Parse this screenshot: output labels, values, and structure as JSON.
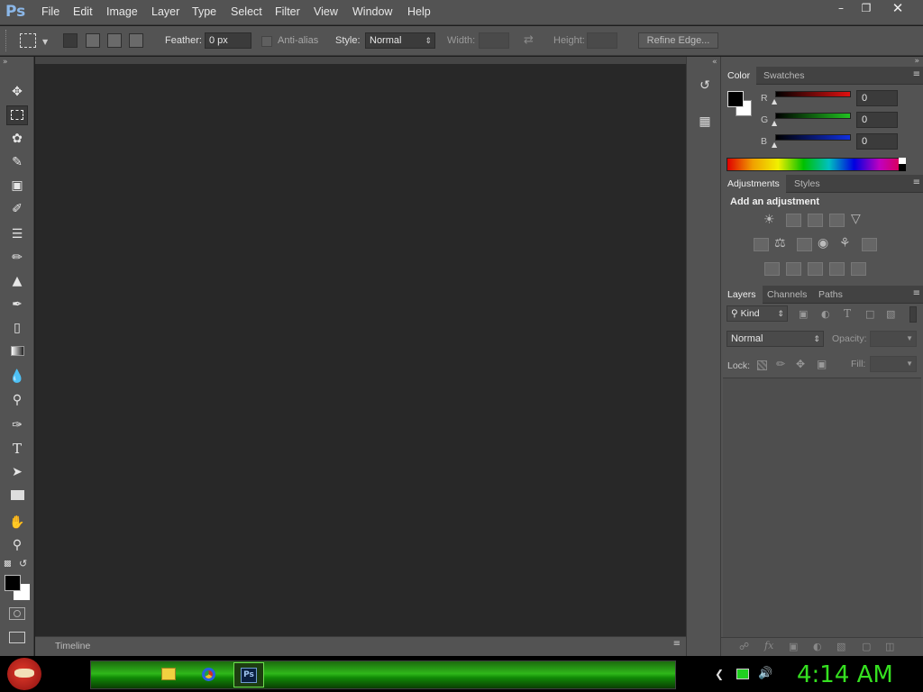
{
  "menubar": {
    "logo": "Ps",
    "items": [
      "File",
      "Edit",
      "Image",
      "Layer",
      "Type",
      "Select",
      "Filter",
      "View",
      "Window",
      "Help"
    ]
  },
  "options": {
    "feather_label": "Feather:",
    "feather_value": "0 px",
    "antialias_label": "Anti-alias",
    "style_label": "Style:",
    "style_value": "Normal",
    "width_label": "Width:",
    "height_label": "Height:",
    "refine_edge": "Refine Edge..."
  },
  "timeline": {
    "label": "Timeline"
  },
  "color_panel": {
    "tabs": [
      "Color",
      "Swatches"
    ],
    "channels": [
      {
        "label": "R",
        "value": "0",
        "color": "#d01010"
      },
      {
        "label": "G",
        "value": "0",
        "color": "#10b010"
      },
      {
        "label": "B",
        "value": "0",
        "color": "#1020d0"
      }
    ]
  },
  "adjustments_panel": {
    "tabs": [
      "Adjustments",
      "Styles"
    ],
    "heading": "Add an adjustment"
  },
  "layers_panel": {
    "tabs": [
      "Layers",
      "Channels",
      "Paths"
    ],
    "filter_kind": "Kind",
    "blend_mode": "Normal",
    "opacity_label": "Opacity:",
    "lock_label": "Lock:",
    "fill_label": "Fill:"
  },
  "taskbar": {
    "clock": "4:14 AM",
    "ps_label": "Ps"
  },
  "colors": {
    "accent_green": "#35e020",
    "panel_bg": "#535353",
    "canvas_bg": "#282828"
  }
}
